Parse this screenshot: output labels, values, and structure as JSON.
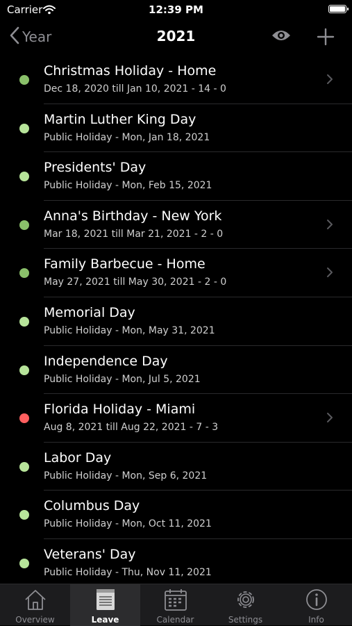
{
  "status": {
    "carrier": "Carrier",
    "time": "12:39 PM"
  },
  "nav": {
    "back_label": "Year",
    "title": "2021"
  },
  "colors": {
    "green": "#8ac06a",
    "lightgreen": "#b7e49a",
    "red": "#ff5f5f"
  },
  "items": [
    {
      "title": "Christmas Holiday - Home",
      "subtitle": "Dec 18, 2020 till Jan 10, 2021 - 14 - 0",
      "dot": "green",
      "chevron": true
    },
    {
      "title": "Martin Luther King Day",
      "subtitle": "Public Holiday - Mon, Jan 18, 2021",
      "dot": "lightgreen",
      "chevron": false
    },
    {
      "title": "Presidents' Day",
      "subtitle": "Public Holiday - Mon, Feb 15, 2021",
      "dot": "lightgreen",
      "chevron": false
    },
    {
      "title": "Anna's Birthday - New York",
      "subtitle": "Mar 18, 2021 till Mar 21, 2021 - 2 - 0",
      "dot": "green",
      "chevron": true
    },
    {
      "title": "Family Barbecue - Home",
      "subtitle": "May 27, 2021 till May 30, 2021 - 2 - 0",
      "dot": "green",
      "chevron": true
    },
    {
      "title": "Memorial Day",
      "subtitle": "Public Holiday - Mon, May 31, 2021",
      "dot": "lightgreen",
      "chevron": false
    },
    {
      "title": "Independence Day",
      "subtitle": "Public Holiday - Mon, Jul 5, 2021",
      "dot": "lightgreen",
      "chevron": false
    },
    {
      "title": "Florida Holiday - Miami",
      "subtitle": "Aug 8, 2021 till Aug 22, 2021 - 7 - 3",
      "dot": "red",
      "chevron": true
    },
    {
      "title": "Labor Day",
      "subtitle": "Public Holiday - Mon, Sep 6, 2021",
      "dot": "lightgreen",
      "chevron": false
    },
    {
      "title": "Columbus Day",
      "subtitle": "Public Holiday - Mon, Oct 11, 2021",
      "dot": "lightgreen",
      "chevron": false
    },
    {
      "title": "Veterans' Day",
      "subtitle": "Public Holiday - Thu, Nov 11, 2021",
      "dot": "lightgreen",
      "chevron": false
    }
  ],
  "tabs": [
    {
      "label": "Overview",
      "icon": "house-icon",
      "active": false
    },
    {
      "label": "Leave",
      "icon": "notepad-icon",
      "active": true
    },
    {
      "label": "Calendar",
      "icon": "calendar-icon",
      "active": false
    },
    {
      "label": "Settings",
      "icon": "gear-icon",
      "active": false
    },
    {
      "label": "Info",
      "icon": "info-icon",
      "active": false
    }
  ]
}
